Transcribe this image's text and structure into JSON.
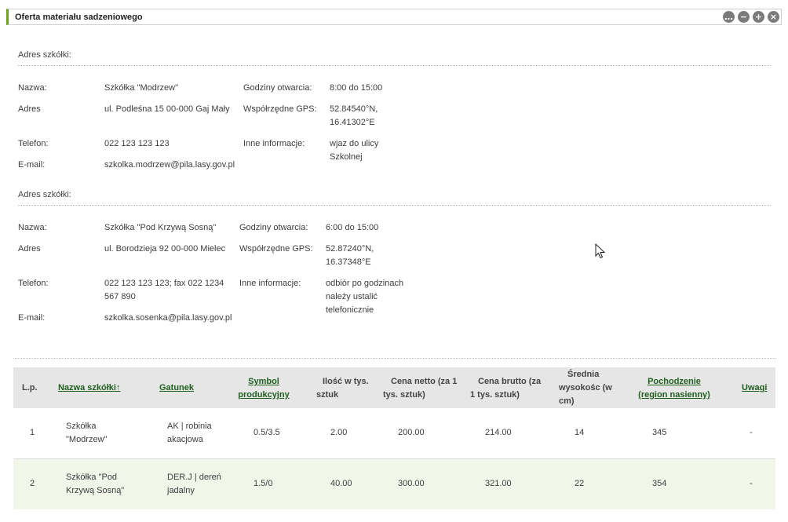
{
  "panel": {
    "title": "Oferta materiału sadzeniowego",
    "icons": [
      "more-icon",
      "minimize-icon",
      "expand-icon",
      "close-icon"
    ]
  },
  "nurseries": [
    {
      "section_title": "Adres szkółki:",
      "labels": {
        "name": "Nazwa:",
        "address": "Adres",
        "phone": "Telefon:",
        "email": "E-mail:",
        "hours": "Godziny otwarcia:",
        "gps": "Współrzędne GPS:",
        "info": "Inne informacje:"
      },
      "name": "Szkółka \"Modrzew\"",
      "address": "ul. Podleśna 15 00-000 Gaj Mały",
      "phone": "022 123 123 123",
      "email": "szkolka.modrzew@pila.lasy.gov.pl",
      "hours": "8:00 do 15:00",
      "gps_lat": "52.84540°N,",
      "gps_lon": "16.41302°E",
      "info_line1": "wjaz do ulicy",
      "info_line2": "Szkolnej"
    },
    {
      "section_title": "Adres szkółki:",
      "labels": {
        "name": "Nazwa:",
        "address": "Adres",
        "phone": "Telefon:",
        "email": "E-mail:",
        "hours": "Godziny otwarcia:",
        "gps": "Współrzędne GPS:",
        "info": "Inne informacje:"
      },
      "name": "Szkółka \"Pod Krzywą Sosną\"",
      "address": "ul. Borodzieja 92 00-000 Mielec",
      "phone_line1": "022 123 123 123; fax 022 1234",
      "phone_line2": "567 890",
      "email": "szkolka.sosenka@pila.lasy.gov.pl",
      "hours": "6:00 do 15:00",
      "gps_lat": "52.87240°N,",
      "gps_lon": "16.37348°E",
      "info_line1": "odbiór po godzinach",
      "info_line2": "należy ustalić",
      "info_line3": "telefonicznie"
    }
  ],
  "table": {
    "headers": {
      "lp": "L.p.",
      "name": "Nazwa szkółki↑",
      "species": "Gatunek",
      "symbol_1": "Symbol",
      "symbol_2": "produkcyjny",
      "qty_1": "Ilość w tys.",
      "qty_2": "sztuk",
      "net_1": "Cena netto (za 1",
      "net_2": "tys. sztuk)",
      "gross_1": "Cena brutto (za",
      "gross_2": "1 tys. sztuk)",
      "height_1": "Średnia",
      "height_2": "wysokośc (w",
      "height_3": "cm)",
      "origin_1": "Pochodzenie",
      "origin_2": "(region nasienny)",
      "notes": "Uwagi"
    },
    "rows": [
      {
        "lp": "1",
        "name_1": "Szkółka",
        "name_2": "\"Modrzew\"",
        "species_1": "AK | robinia",
        "species_2": "akacjowa",
        "symbol": "0.5/3.5",
        "qty": "2.00",
        "net": "200.00",
        "gross": "214.00",
        "height": "14",
        "origin": "345",
        "notes": "-"
      },
      {
        "lp": "2",
        "name_1": "Szkółka \"Pod",
        "name_2": "Krzywą Sosną\"",
        "species_1": "DER.J | dereń",
        "species_2": "jadalny",
        "symbol": "1.5/0",
        "qty": "40.00",
        "net": "300.00",
        "gross": "321.00",
        "height": "22",
        "origin": "354",
        "notes": "-"
      }
    ]
  }
}
